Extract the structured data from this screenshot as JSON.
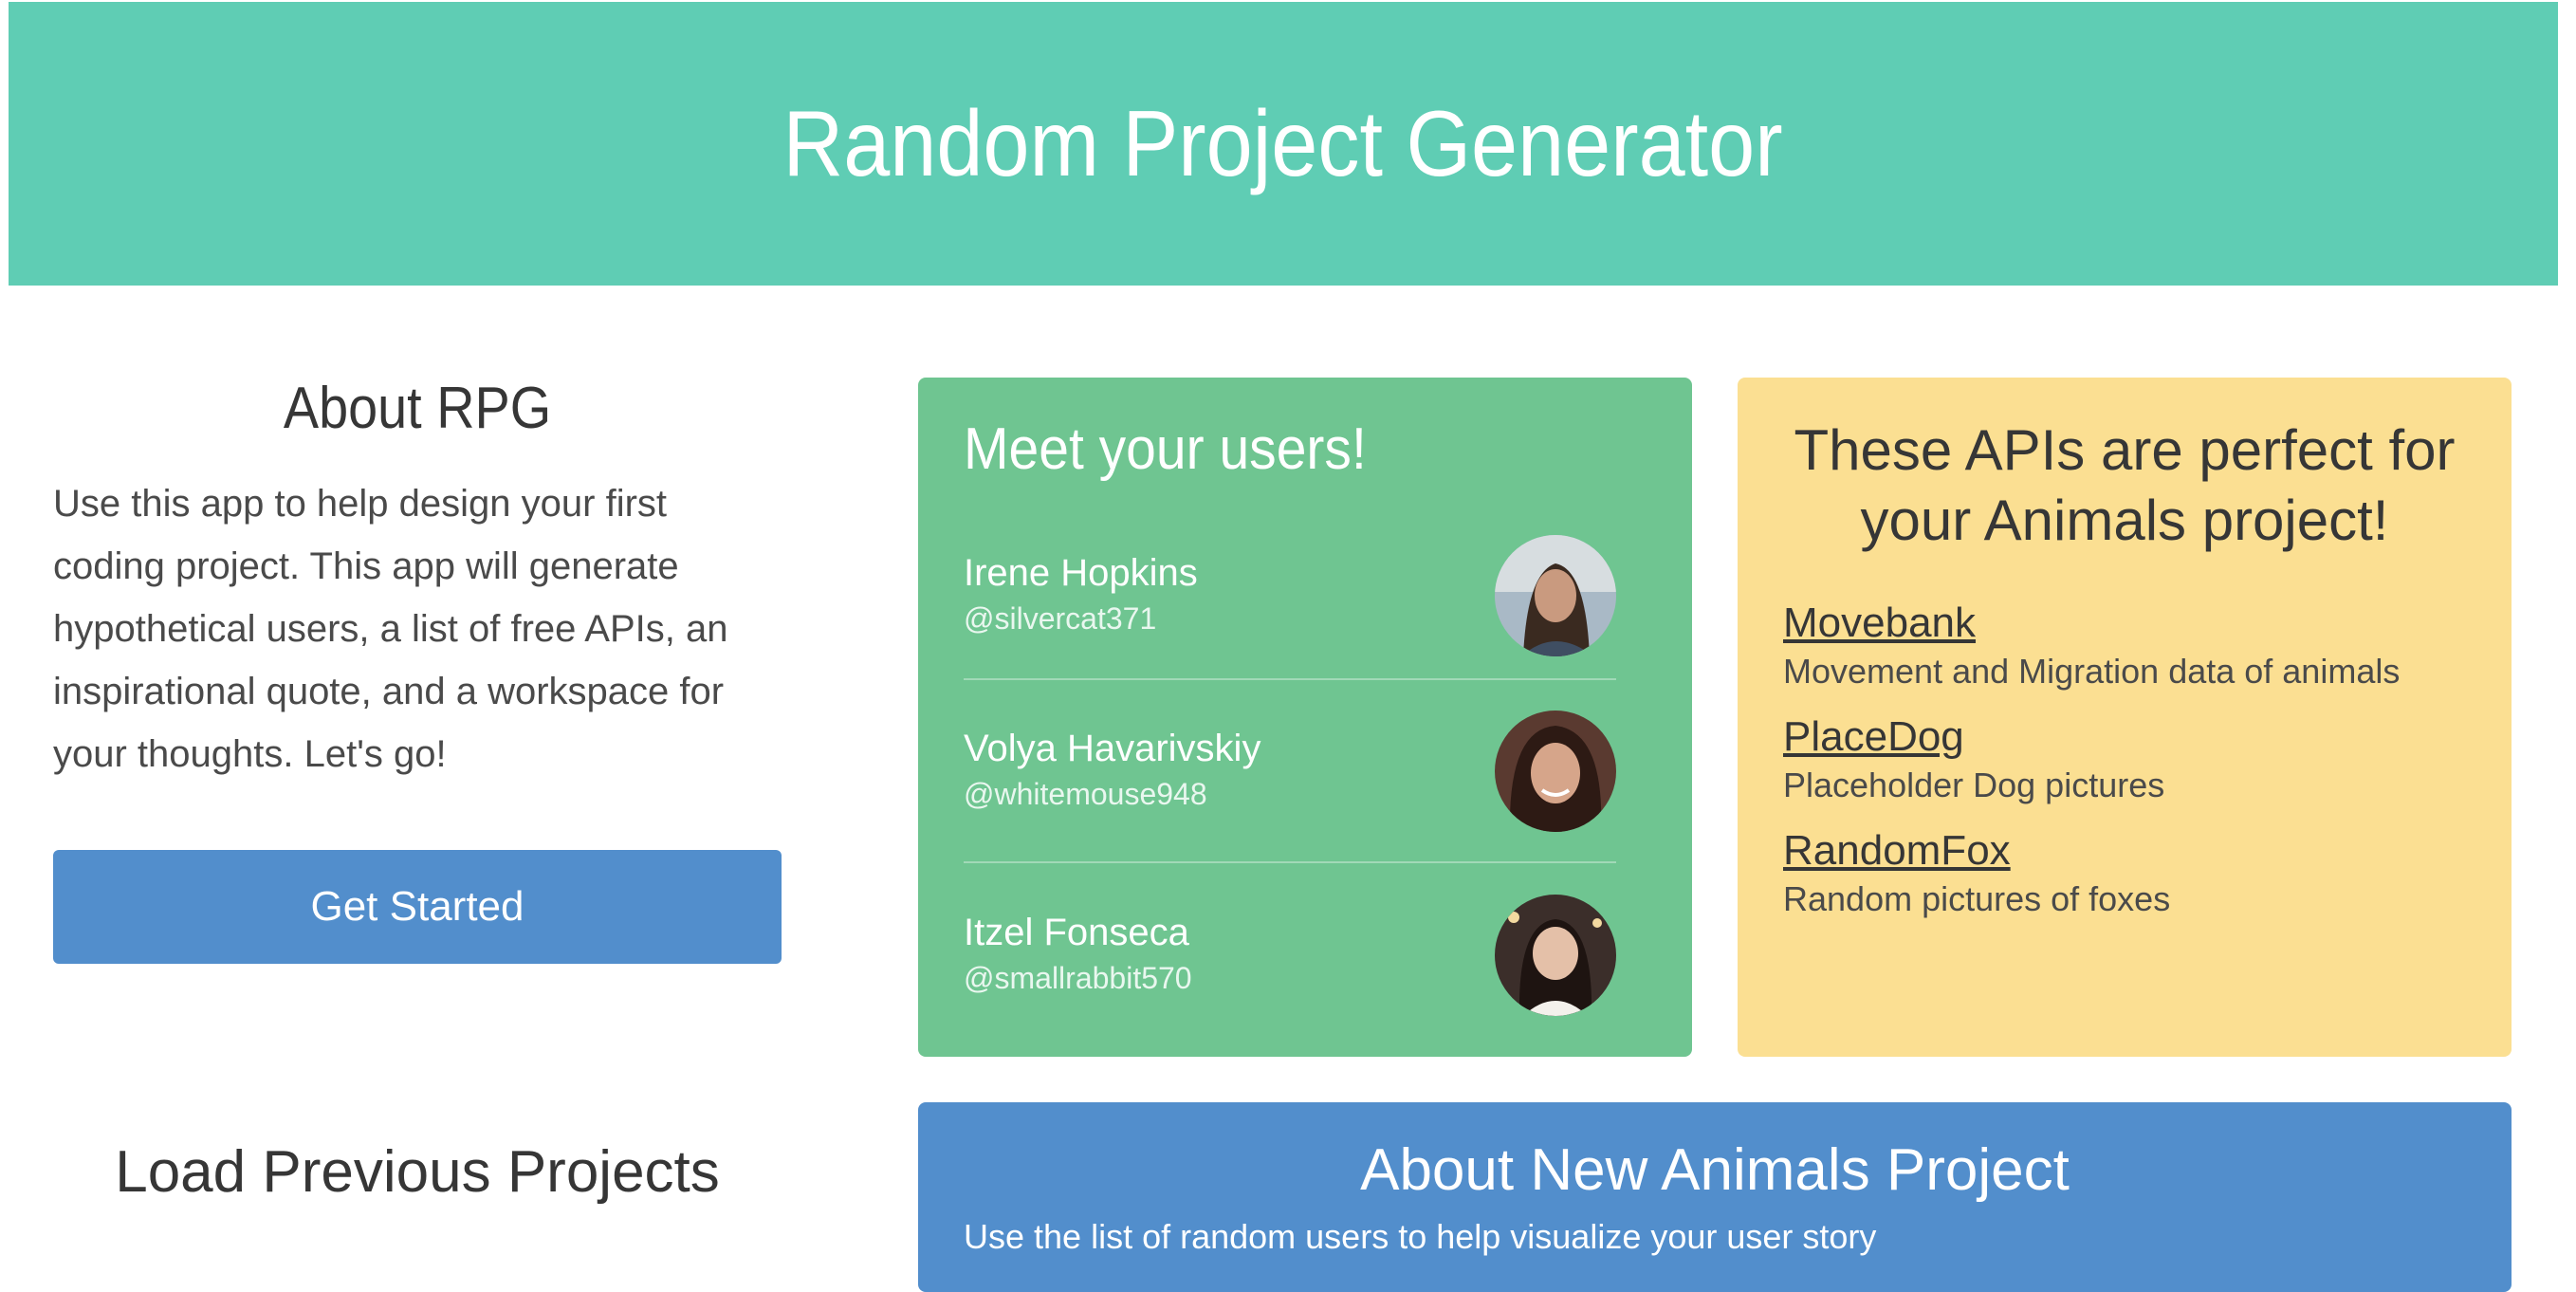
{
  "header": {
    "title": "Random Project Generator"
  },
  "about": {
    "title": "About RPG",
    "description": "Use this app to help design your first coding project. This app will generate hypothetical users, a list of free APIs, an inspirational quote, and a workspace for your thoughts. Let's go!",
    "button_label": "Get Started"
  },
  "load_previous": {
    "title": "Load Previous Projects"
  },
  "users": {
    "title": "Meet your users!",
    "items": [
      {
        "name": "Irene Hopkins",
        "handle": "@silvercat371"
      },
      {
        "name": "Volya Havarivskiy",
        "handle": "@whitemouse948"
      },
      {
        "name": "Itzel Fonseca",
        "handle": "@smallrabbit570"
      }
    ]
  },
  "apis": {
    "title": "These APIs are perfect for your Animals project!",
    "items": [
      {
        "name": "Movebank",
        "description": "Movement and Migration data of animals"
      },
      {
        "name": "PlaceDog",
        "description": "Placeholder Dog pictures"
      },
      {
        "name": "RandomFox",
        "description": "Random pictures of foxes"
      }
    ]
  },
  "project": {
    "title": "About New Animals Project",
    "description": "Use the list of random users to help visualize your user story"
  },
  "colors": {
    "hero": "#5fcdb4",
    "users_card": "#6fc591",
    "apis_card": "#fbdf92",
    "primary_button": "#528ecc"
  }
}
